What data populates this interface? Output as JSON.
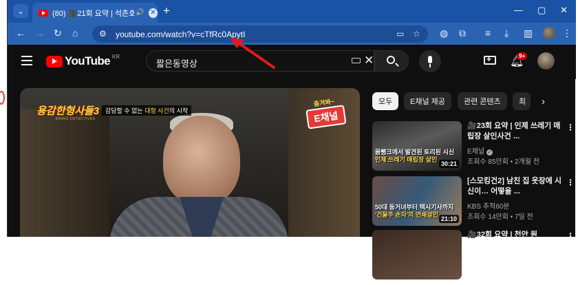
{
  "browser": {
    "tab_title": "(80) 🎥21회 요약 | 석촌호",
    "new_tab_label": "+",
    "window_controls": [
      "—",
      "▢",
      "✕"
    ],
    "url": "youtube.com/watch?v=cTfRc0ApytI"
  },
  "youtube": {
    "logo_text": "YouTube",
    "region": "KR",
    "search_value": "짧은동영상",
    "notification_count": "9+"
  },
  "player": {
    "show_logo": "용감한형사들3",
    "show_logo_sub": "BRAVE DETECTIVES",
    "caption_prefix": "감당할 수 없는 ",
    "caption_highlight": "대형 사건",
    "caption_suffix": "의 시작",
    "sticker_top": "춤겨봐~",
    "sticker_main": "E채널"
  },
  "chips": [
    "모두",
    "E채널 제공",
    "관련 콘텐츠",
    "최"
  ],
  "recommended": [
    {
      "title": "🎥23회 요약 | 인제 쓰레기 매립장 살인사건 ...",
      "channel": "E채널",
      "verified": true,
      "meta": "조회수 85만회 • 2개월 전",
      "overlay_line1": "몸뻥크에서 발견된 토리된 시신",
      "overlay_line2": "인제 쓰레기 매립장 살인",
      "duration": "30:21"
    },
    {
      "title": "[스모킹건2] 남친 집 옷장에 시신이… 어떻을 ...",
      "channel": "KBS 추적60분",
      "verified": false,
      "meta": "조회수 14만회 • 7일 전",
      "overlay_line1": "50대 동거녀부터 택시기사까지",
      "overlay_line2": "'건물주 손자'의 연쇄살인",
      "duration": "21:10"
    },
    {
      "title": "🎥32회 요약 | 천안 원",
      "channel": "",
      "verified": false,
      "meta": "",
      "overlay_line1": "",
      "overlay_line2": "",
      "duration": ""
    }
  ],
  "colors": {
    "browser_accent": "#1a53a6",
    "youtube_red": "#ff0000",
    "annotation_arrow": "#e01b1b"
  }
}
